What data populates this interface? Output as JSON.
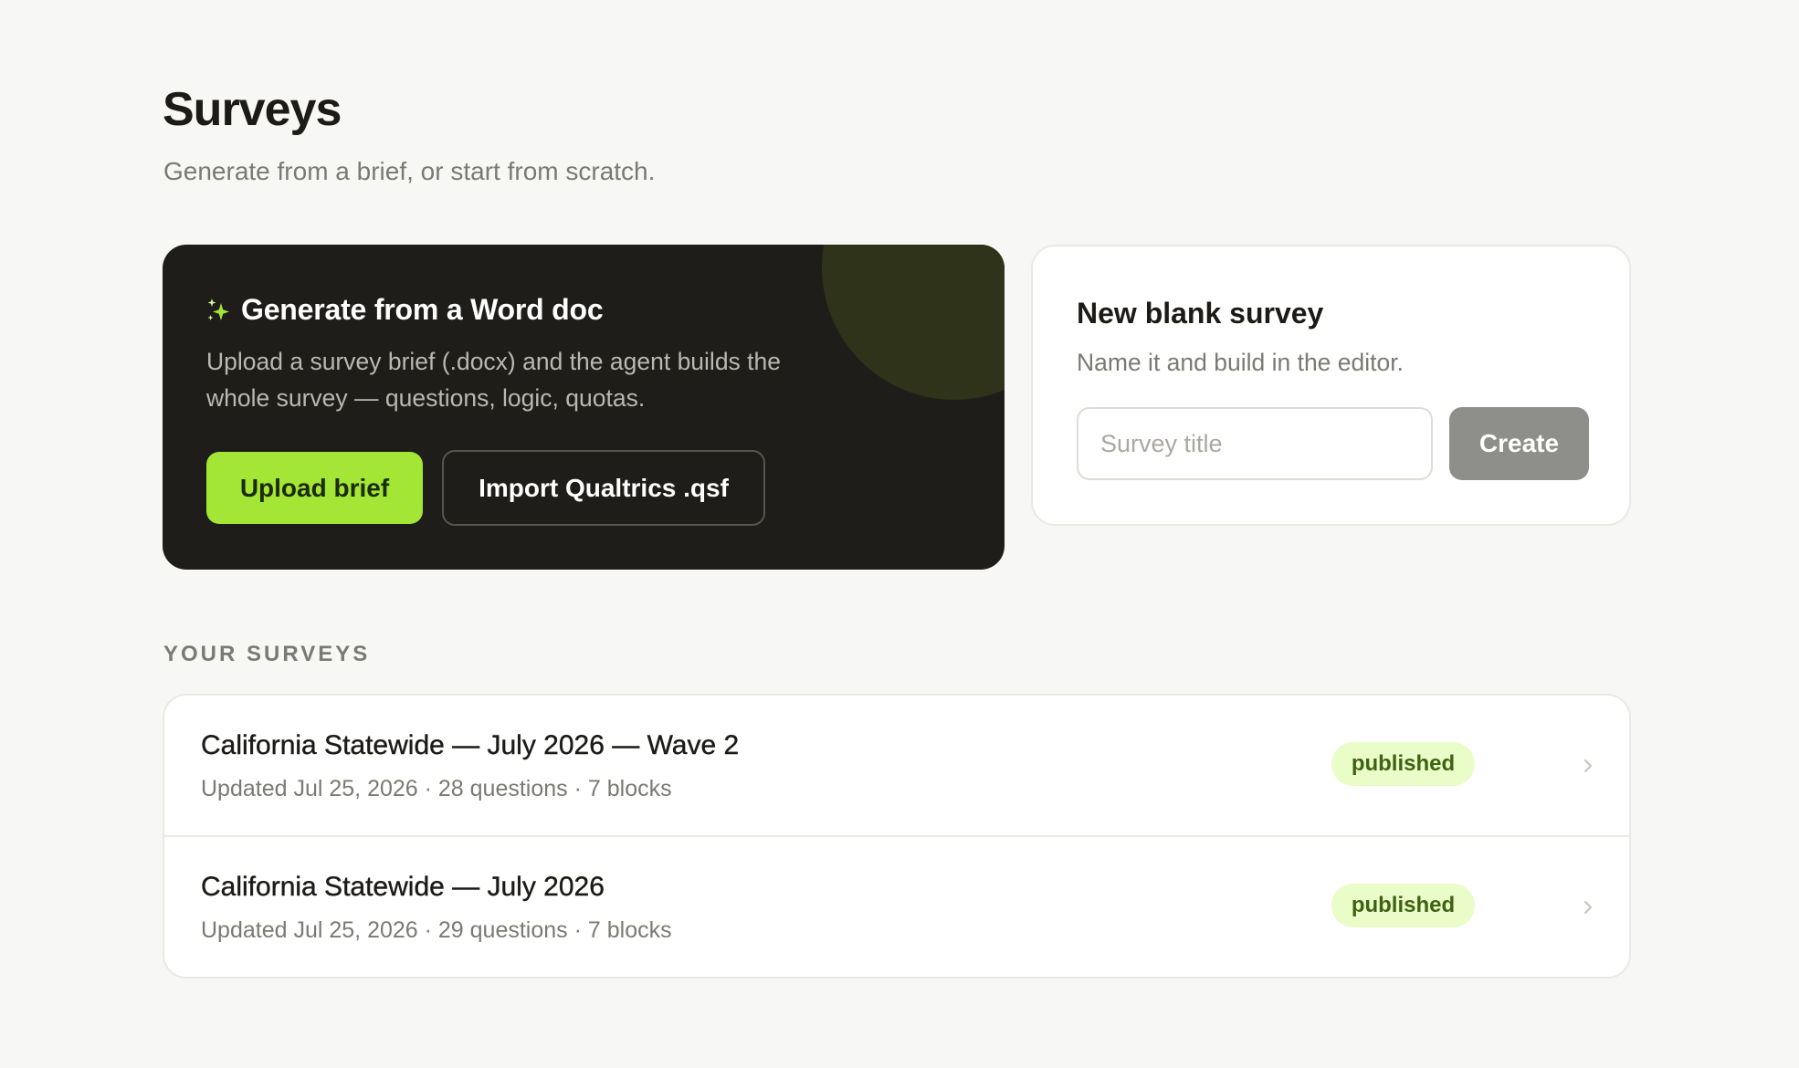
{
  "header": {
    "title": "Surveys",
    "subtitle": "Generate from a brief, or start from scratch."
  },
  "generate_card": {
    "icon": "sparkle-icon",
    "title": "Generate from a Word doc",
    "description": "Upload a survey brief (.docx) and the agent builds the whole survey — questions, logic, quotas.",
    "upload_label": "Upload brief",
    "import_label": "Import Qualtrics .qsf"
  },
  "blank_card": {
    "title": "New blank survey",
    "description": "Name it and build in the editor.",
    "input_value": "",
    "input_placeholder": "Survey title",
    "create_label": "Create"
  },
  "surveys_section": {
    "label": "YOUR SURVEYS",
    "items": [
      {
        "title": "California Statewide — July 2026 — Wave 2",
        "meta": "Updated Jul 25, 2026 · 28 questions · 7 blocks",
        "status": "published"
      },
      {
        "title": "California Statewide — July 2026",
        "meta": "Updated Jul 25, 2026 · 29 questions · 7 blocks",
        "status": "published"
      }
    ]
  },
  "colors": {
    "accent": "#a3e635",
    "dark_card": "#1e1d19",
    "background": "#f7f7f5",
    "status_published_bg": "#eafcc8",
    "status_published_text": "#3e6212"
  }
}
